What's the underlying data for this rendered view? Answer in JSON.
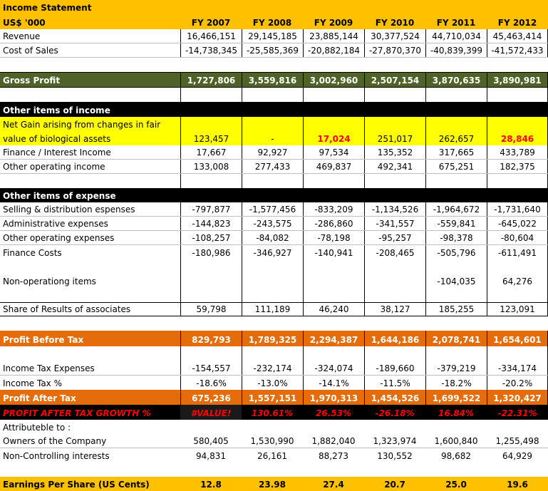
{
  "title": "Income Statement",
  "currency": "US$ '000",
  "years": [
    "FY 2007",
    "FY 2008",
    "FY 2009",
    "FY 2010",
    "FY 2011",
    "FY 2012"
  ],
  "revenue": {
    "label": "Revenue",
    "values": [
      "16,466,151",
      "29,145,185",
      "23,885,144",
      "30,377,524",
      "44,710,034",
      "45,463,414"
    ]
  },
  "cost_of_sales": {
    "label": "Cost of Sales",
    "values": [
      "-14,738,345",
      "-25,585,369",
      "-20,882,184",
      "-27,870,370",
      "-40,839,399",
      "-41,572,433"
    ]
  },
  "gross_profit": {
    "label": "Gross Profit",
    "values": [
      "1,727,806",
      "3,559,816",
      "3,002,960",
      "2,507,154",
      "3,870,635",
      "3,890,981"
    ]
  },
  "other_income_header": "Other items of income",
  "net_gain": {
    "label": "Net Gain arising from changes in fair value of biological assets",
    "values": [
      "123,457",
      "-",
      "17,024",
      "251,017",
      "262,657",
      "28,846"
    ]
  },
  "finance_income": {
    "label": "Finance / Interest Income",
    "values": [
      "17,667",
      "92,927",
      "97,534",
      "135,352",
      "317,665",
      "433,789"
    ]
  },
  "other_op_income": {
    "label": "Other operating income",
    "values": [
      "133,008",
      "277,433",
      "469,837",
      "492,341",
      "675,251",
      "182,375"
    ]
  },
  "other_expense_header": "Other items of expense",
  "selling": {
    "label": "Selling & distribution espenses",
    "values": [
      "-797,877",
      "-1,577,456",
      "-833,209",
      "-1,134,526",
      "-1,964,672",
      "-1,731,640"
    ]
  },
  "admin": {
    "label": "Administrative expenses",
    "values": [
      "-144,823",
      "-243,575",
      "-286,860",
      "-341,557",
      "-559,841",
      "-645,022"
    ]
  },
  "other_op_exp": {
    "label": "Other operating expenses",
    "values": [
      "-108,257",
      "-84,082",
      "-78,198",
      "-95,257",
      "-98,378",
      "-80,604"
    ]
  },
  "finance_costs": {
    "label": "Finance Costs",
    "values": [
      "-180,986",
      "-346,927",
      "-140,941",
      "-208,465",
      "-505,796",
      "-611,491"
    ]
  },
  "non_operating": {
    "label": "Non-operationg items",
    "values": [
      "",
      "",
      "",
      "",
      "-104,035",
      "64,276"
    ]
  },
  "associates": {
    "label": "Share of Results of associates",
    "values": [
      "59,798",
      "111,189",
      "46,240",
      "38,127",
      "185,255",
      "123,091"
    ]
  },
  "pbt": {
    "label": "Profit Before Tax",
    "values": [
      "829,793",
      "1,789,325",
      "2,294,387",
      "1,644,186",
      "2,078,741",
      "1,654,601"
    ]
  },
  "tax": {
    "label": "Income Tax Expenses",
    "values": [
      "-154,557",
      "-232,174",
      "-324,074",
      "-189,660",
      "-379,219",
      "-334,174"
    ]
  },
  "tax_pct": {
    "label": "Income Tax %",
    "values": [
      "-18.6%",
      "-13.0%",
      "-14.1%",
      "-11.5%",
      "-18.2%",
      "-20.2%"
    ]
  },
  "pat": {
    "label": "Profit After Tax",
    "values": [
      "675,236",
      "1,557,151",
      "1,970,313",
      "1,454,526",
      "1,699,522",
      "1,320,427"
    ]
  },
  "pat_growth": {
    "label": "PROFIT AFTER TAX GROWTH %",
    "values": [
      "#VALUE!",
      "130.61%",
      "26.53%",
      "-26.18%",
      "16.84%",
      "-22.31%"
    ]
  },
  "attributable": "Attributeble to :",
  "owners": {
    "label": "Owners of the Company",
    "values": [
      "580,405",
      "1,530,990",
      "1,882,040",
      "1,323,974",
      "1,600,840",
      "1,255,498"
    ]
  },
  "nci": {
    "label": "Non-Controlling interests",
    "values": [
      "94,831",
      "26,161",
      "88,273",
      "130,552",
      "98,682",
      "64,929"
    ]
  },
  "eps": {
    "label": "Earnings Per Share (US Cents)",
    "values": [
      "12.8",
      "23.98",
      "27.4",
      "20.7",
      "25.0",
      "19.6"
    ]
  },
  "colors": {
    "header": "#FFC000",
    "gross": "#4F6228",
    "section": "#000000",
    "highlight": "#FFFF00",
    "pbt": "#E46C0A",
    "negative_growth": "#FF0000"
  }
}
